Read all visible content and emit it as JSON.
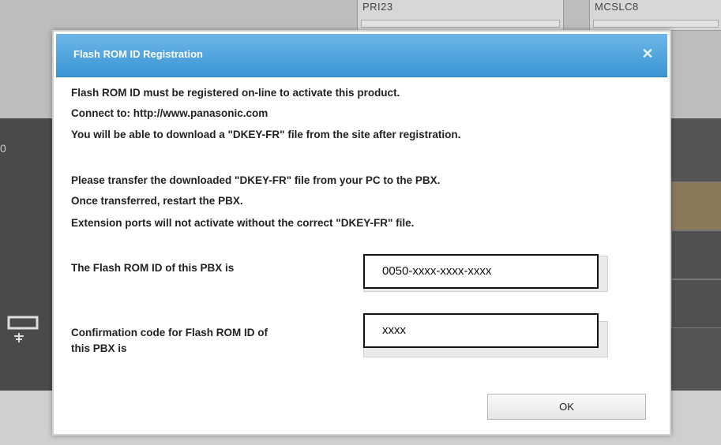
{
  "background": {
    "slot_left": "PRI23",
    "slot_right": "MCSLC8",
    "band_label": "0"
  },
  "dialog": {
    "title": "Flash ROM ID Registration",
    "close_icon": "close-icon",
    "messages": [
      "Flash ROM ID must be registered on-line to activate this product.",
      "Connect to: http://www.panasonic.com",
      "You will be able to download a \"DKEY-FR\" file from the site after registration.",
      "Please transfer the downloaded \"DKEY-FR\" file from your PC to the PBX.",
      "Once transferred, restart the PBX.",
      "Extension ports will not activate without the correct \"DKEY-FR\" file."
    ],
    "flash_rom_id": {
      "label": "The Flash ROM ID of this PBX is",
      "value": "0050-xxxx-xxxx-xxxx"
    },
    "confirmation_code": {
      "label_line1": "Confirmation code for Flash ROM ID of",
      "label_line2": "this PBX is",
      "value": "xxxx"
    },
    "ok_label": "OK"
  },
  "colors": {
    "header_top": "#6cb6e8",
    "header_bottom": "#3b95d4"
  }
}
